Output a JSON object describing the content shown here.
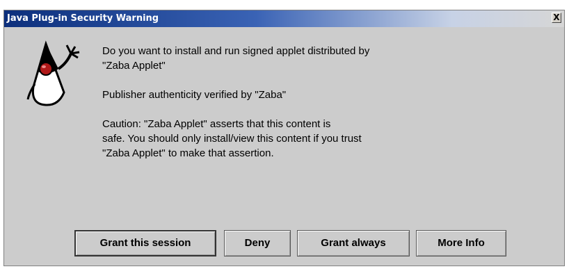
{
  "dialog": {
    "title": "Java Plug-in Security Warning",
    "close_label": "X",
    "icon": "duke-mascot-icon",
    "message": [
      "Do you want to install and run signed applet distributed by\n\"Zaba Applet\"",
      "Publisher authenticity verified by \"Zaba\"",
      "Caution: \"Zaba Applet\" asserts that this content is\nsafe. You should only install/view this content if you trust\n\"Zaba Applet\" to make that assertion."
    ],
    "buttons": {
      "grant_session": "Grant this session",
      "deny": "Deny",
      "grant_always": "Grant always",
      "more_info": "More Info"
    }
  },
  "colors": {
    "titlebar_start": "#0c2f7c",
    "dialog_background": "#cccccc"
  }
}
